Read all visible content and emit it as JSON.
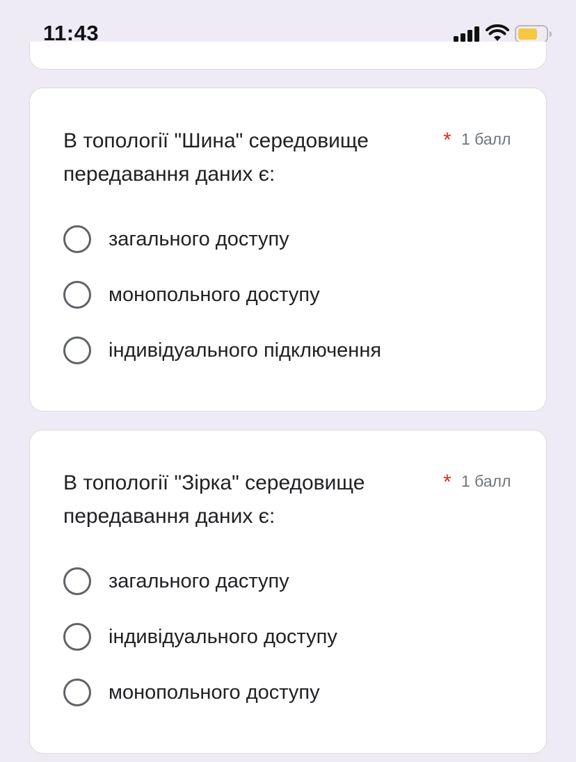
{
  "status_bar": {
    "time": "11:43",
    "icons": [
      "signal-icon",
      "wifi-icon",
      "battery-icon"
    ],
    "battery_color": "#f5c842"
  },
  "questions": [
    {
      "text": "В топології \"Шина\" середовище передавання даних є:",
      "required_mark": "*",
      "points": "1 балл",
      "options": [
        {
          "label": "загального доступу"
        },
        {
          "label": "монопольного доступу"
        },
        {
          "label": "індивідуального підключення"
        }
      ]
    },
    {
      "text": "В топології \"Зірка\" середовище передавання даних є:",
      "required_mark": "*",
      "points": "1 балл",
      "options": [
        {
          "label": "загального даступу"
        },
        {
          "label": "індивідуального доступу"
        },
        {
          "label": "монопольного доступу"
        }
      ]
    }
  ],
  "colors": {
    "background": "#efebf6",
    "required": "#d93025",
    "radio_border": "#5f6368"
  }
}
